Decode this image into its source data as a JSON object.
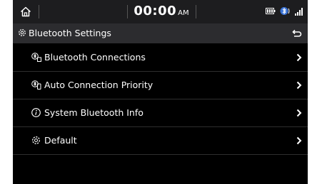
{
  "status": {
    "time": "00:00",
    "ampm": "AM",
    "icons": [
      "home-icon",
      "battery-icon",
      "bluetooth-phone-icon",
      "signal-icon"
    ]
  },
  "header": {
    "title": "Bluetooth Settings",
    "title_icon": "gear-icon",
    "back_icon": "back-arrow-icon"
  },
  "menu": {
    "items": [
      {
        "label": "Bluetooth Connections",
        "icon": "bluetooth-devices-icon"
      },
      {
        "label": "Auto Connection Priority",
        "icon": "bluetooth-priority-icon"
      },
      {
        "label": "System Bluetooth Info",
        "icon": "info-icon"
      },
      {
        "label": "Default",
        "icon": "gear-icon"
      }
    ]
  },
  "colors": {
    "screen_bg": "#000000",
    "statusbar_bg": "#1d1d1f",
    "titlebar_bg": "#2c2c2f",
    "divider": "#2e2e2e",
    "text": "#ffffff"
  }
}
